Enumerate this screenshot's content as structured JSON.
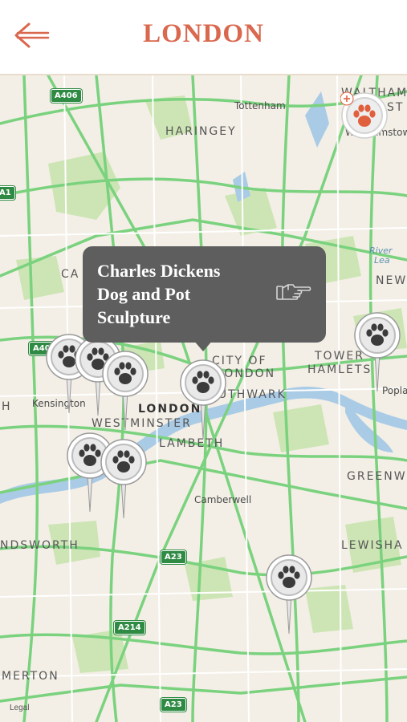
{
  "header": {
    "title": "LONDON",
    "back_icon": "back-arrow-icon",
    "accent_color": "#d9684e"
  },
  "map": {
    "labels": [
      {
        "id": "tottenham",
        "text": "Tottenham"
      },
      {
        "id": "haringey",
        "text": "HARINGEY"
      },
      {
        "id": "walthamstow-a",
        "text": "WALTHAM"
      },
      {
        "id": "walthamstow-b",
        "text": "ST"
      },
      {
        "id": "walthamstow-c",
        "text": "Walthamstow"
      },
      {
        "id": "camden",
        "text": "CA"
      },
      {
        "id": "river-lea-a",
        "text": "River"
      },
      {
        "id": "river-lea-b",
        "text": "Lea"
      },
      {
        "id": "newham",
        "text": "NEW"
      },
      {
        "id": "city-a",
        "text": "CITY OF"
      },
      {
        "id": "city-b",
        "text": "LONDON"
      },
      {
        "id": "tower-a",
        "text": "TOWER"
      },
      {
        "id": "tower-b",
        "text": "HAMLETS"
      },
      {
        "id": "poplar",
        "text": "Poplar"
      },
      {
        "id": "kensington",
        "text": "Kensington"
      },
      {
        "id": "london",
        "text": "LONDON"
      },
      {
        "id": "southwark",
        "text": "SOUTHWARK"
      },
      {
        "id": "westminster",
        "text": "WESTMINSTER"
      },
      {
        "id": "lambeth",
        "text": "LAMBETH"
      },
      {
        "id": "greenwich",
        "text": "GREENWI"
      },
      {
        "id": "camberwell",
        "text": "Camberwell"
      },
      {
        "id": "wandsworth",
        "text": "NDSWORTH"
      },
      {
        "id": "lewisham",
        "text": "LEWISHA"
      },
      {
        "id": "merton",
        "text": "MERTON"
      },
      {
        "id": "h-edge",
        "text": "H"
      }
    ],
    "road_shields": [
      {
        "id": "a406",
        "text": "A406"
      },
      {
        "id": "a40",
        "text": "A40"
      },
      {
        "id": "a1",
        "text": "A1"
      },
      {
        "id": "a23",
        "text": "A23"
      },
      {
        "id": "a214",
        "text": "A214"
      },
      {
        "id": "a23b",
        "text": "A23"
      }
    ],
    "legal": "Legal"
  },
  "popup": {
    "title_line1": "Charles Dickens",
    "title_line2": "Dog and Pot",
    "title_line3": "Sculpture",
    "detail_icon": "pointing-hand-icon"
  },
  "pins": {
    "icon": "paw-icon",
    "count": 8
  },
  "badge": {
    "icon": "paw-icon",
    "add_icon": "plus-icon",
    "color": "#e0603e"
  }
}
